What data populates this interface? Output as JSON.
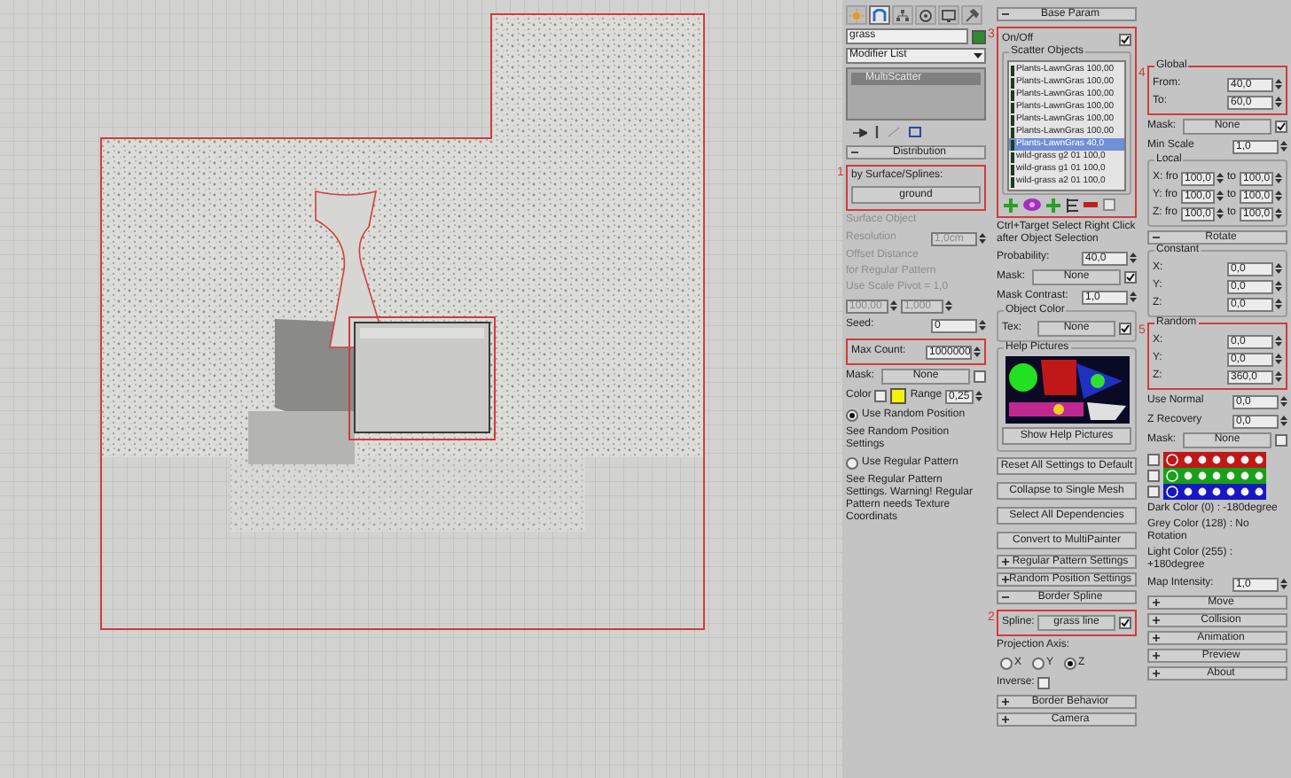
{
  "columns": [
    {
      "rows": [
        {
          "kind": "command_tabs",
          "tabs": [
            {
              "selected": false
            },
            {
              "selected": true
            },
            {
              "selected": false
            },
            {
              "selected": false
            },
            {
              "selected": false
            },
            {
              "selected": false
            }
          ]
        },
        {
          "kind": "name",
          "value": "grass",
          "color": "#2f8a2f"
        },
        {
          "kind": "dropdown",
          "value": "Modifier List"
        },
        {
          "kind": "stack",
          "items": [
            {
              "label": "MultiScatter",
              "selected": true
            }
          ]
        },
        {
          "kind": "stack_toolbar"
        },
        {
          "kind": "rollout",
          "label": "Distribution",
          "expanded": true
        },
        {
          "kind": "group",
          "highlighted": true,
          "callout": "1",
          "children": [
            {
              "kind": "text",
              "text": "by Surface/Splines:"
            },
            {
              "kind": "button",
              "label": "ground"
            }
          ]
        },
        {
          "kind": "text",
          "text": "Surface Object",
          "disabled": true
        },
        {
          "kind": "spinner",
          "label": "Resolution",
          "value": "1,0cm",
          "disabled": true
        },
        {
          "kind": "text",
          "text": "Offset Distance",
          "disabled": true
        },
        {
          "kind": "text",
          "text": "for Regular Pattern",
          "disabled": true
        },
        {
          "kind": "text",
          "text": "Use Scale Pivot = 1,0",
          "disabled": true
        },
        {
          "kind": "pair",
          "value": "100,00",
          "value2": "1,000",
          "disabled": true
        },
        {
          "kind": "spinner",
          "label": "Seed:",
          "value": "0"
        },
        {
          "kind": "group",
          "highlighted": true,
          "children": [
            {
              "kind": "spinner",
              "label": "Max Count:",
              "value": "1000000"
            }
          ]
        },
        {
          "kind": "pick",
          "label": "Mask:",
          "value": "None",
          "checked": false
        },
        {
          "kind": "color",
          "label": "Color",
          "checked": false,
          "color": "#f2f20a",
          "label2": "Range",
          "value": "0,25"
        },
        {
          "kind": "radio",
          "label": "Use Random Position",
          "selected": true
        },
        {
          "kind": "text",
          "text": "See Random Position Settings"
        },
        {
          "kind": "radio",
          "label": "Use Regular Pattern",
          "selected": false
        },
        {
          "kind": "text",
          "text": "See Regular Pattern Settings. Warning! Regular Pattern needs Texture Coordinats"
        }
      ]
    },
    {
      "rows": [
        {
          "kind": "rollout",
          "label": "Base Param",
          "expanded": true
        },
        {
          "kind": "group",
          "highlighted": true,
          "callout": "3",
          "children": [
            {
              "kind": "toggle",
              "label": "On/Off",
              "checked": true
            },
            {
              "kind": "group",
              "title": "Scatter Objects",
              "children": [
                {
                  "kind": "list",
                  "items": [
                    {
                      "label": "Plants-LawnGras 100,00",
                      "selected": false
                    },
                    {
                      "label": "Plants-LawnGras 100,00",
                      "selected": false
                    },
                    {
                      "label": "Plants-LawnGras 100,00",
                      "selected": false
                    },
                    {
                      "label": "Plants-LawnGras 100,00",
                      "selected": false
                    },
                    {
                      "label": "Plants-LawnGras 100,00",
                      "selected": false
                    },
                    {
                      "label": "Plants-LawnGras 100,00",
                      "selected": false
                    },
                    {
                      "label": "Plants-LawnGras 40,0",
                      "selected": true
                    },
                    {
                      "label": "wild-grass g2 01 100,0",
                      "selected": false
                    },
                    {
                      "label": "wild-grass g1 01 100,0",
                      "selected": false
                    },
                    {
                      "label": "wild-grass a2 01 100,0",
                      "selected": false
                    }
                  ]
                }
              ]
            },
            {
              "kind": "list_toolbar"
            }
          ]
        },
        {
          "kind": "text",
          "text": "Ctrl+Target Select Right Click after Object Selection"
        },
        {
          "kind": "spinner",
          "label": "Probability:",
          "value": "40,0"
        },
        {
          "kind": "pick",
          "label": "Mask:",
          "value": "None",
          "checked": true
        },
        {
          "kind": "spinner",
          "label": "Mask Contrast:",
          "value": "1,0"
        },
        {
          "kind": "group",
          "title": "Object Color",
          "children": [
            {
              "kind": "pick",
              "label": "Tex:",
              "value": "None",
              "checked": true
            }
          ]
        },
        {
          "kind": "group",
          "title": "Help Pictures",
          "children": [
            {
              "kind": "help_picture"
            },
            {
              "kind": "button",
              "label": "Show Help Pictures"
            }
          ]
        },
        {
          "kind": "button",
          "label": "Reset All Settings to Default"
        },
        {
          "kind": "button",
          "label": "Collapse to Single Mesh"
        },
        {
          "kind": "button",
          "label": "Select All Dependencies"
        },
        {
          "kind": "button",
          "label": "Convert to MultiPainter"
        },
        {
          "kind": "rollout",
          "label": "Regular Pattern Settings",
          "expanded": false
        },
        {
          "kind": "rollout",
          "label": "Random Position Settings",
          "expanded": false
        },
        {
          "kind": "rollout",
          "label": "Border Spline",
          "expanded": true
        },
        {
          "kind": "group",
          "highlighted": true,
          "callout": "2",
          "children": [
            {
              "kind": "pick",
              "label": "Spline:",
              "value": "grass line",
              "checked": true
            }
          ]
        },
        {
          "kind": "text",
          "text": "Projection Axis:"
        },
        {
          "kind": "radio_row",
          "options": [
            {
              "label": "X",
              "selected": false
            },
            {
              "label": "Y",
              "selected": false
            },
            {
              "label": "Z",
              "selected": true
            }
          ]
        },
        {
          "kind": "check",
          "label": "Inverse:",
          "checked": false
        },
        {
          "kind": "rollout",
          "label": "Border Behavior",
          "expanded": false
        },
        {
          "kind": "rollout",
          "label": "Camera",
          "expanded": false
        }
      ]
    },
    {
      "rows": [
        {
          "kind": "group",
          "title": "Global",
          "highlighted": true,
          "callout": "4",
          "children": [
            {
              "kind": "spinner",
              "label": "From:",
              "value": "40,0"
            },
            {
              "kind": "spinner",
              "label": "To:",
              "value": "60,0"
            }
          ]
        },
        {
          "kind": "pick",
          "label": "Mask:",
          "value": "None",
          "checked": true
        },
        {
          "kind": "spinner",
          "label": "Min Scale",
          "value": "1,0"
        },
        {
          "kind": "group",
          "title": "Local",
          "children": [
            {
              "kind": "pair",
              "label": "X: fro",
              "value": "100,0",
              "label2": "to",
              "value2": "100,0"
            },
            {
              "kind": "pair",
              "label": "Y: fro",
              "value": "100,0",
              "label2": "to",
              "value2": "100,0"
            },
            {
              "kind": "pair",
              "label": "Z: fro",
              "value": "100,0",
              "label2": "to",
              "value2": "100,0"
            }
          ]
        },
        {
          "kind": "rollout",
          "label": "Rotate",
          "expanded": true
        },
        {
          "kind": "group",
          "title": "Constant",
          "children": [
            {
              "kind": "spinner",
              "label": "X:",
              "value": "0,0"
            },
            {
              "kind": "spinner",
              "label": "Y:",
              "value": "0,0"
            },
            {
              "kind": "spinner",
              "label": "Z:",
              "value": "0,0"
            }
          ]
        },
        {
          "kind": "group",
          "title": "Random",
          "highlighted": true,
          "callout": "5",
          "children": [
            {
              "kind": "spinner",
              "label": "X:",
              "value": "0,0"
            },
            {
              "kind": "spinner",
              "label": "Y:",
              "value": "0,0"
            },
            {
              "kind": "spinner",
              "label": "Z:",
              "value": "360,0"
            }
          ]
        },
        {
          "kind": "spinner",
          "label": "Use Normal",
          "value": "0,0"
        },
        {
          "kind": "spinner",
          "label": "Z Recovery",
          "value": "0,0"
        },
        {
          "kind": "pick",
          "label": "Mask:",
          "value": "None",
          "checked": false
        },
        {
          "kind": "axis_maps",
          "checks": [
            {
              "checked": false
            },
            {
              "checked": false
            },
            {
              "checked": false
            }
          ]
        },
        {
          "kind": "text",
          "text": "Dark Color (0)    : -180degree"
        },
        {
          "kind": "text",
          "text": "Grey Color (128) : No Rotation"
        },
        {
          "kind": "text",
          "text": "Light Color (255) : +180degree"
        },
        {
          "kind": "spinner",
          "label": "Map Intensity:",
          "value": "1,0"
        },
        {
          "kind": "rollout",
          "label": "Move",
          "expanded": false
        },
        {
          "kind": "rollout",
          "label": "Collision",
          "expanded": false
        },
        {
          "kind": "rollout",
          "label": "Animation",
          "expanded": false
        },
        {
          "kind": "rollout",
          "label": "Preview",
          "expanded": false
        },
        {
          "kind": "rollout",
          "label": "About",
          "expanded": false
        }
      ]
    }
  ]
}
